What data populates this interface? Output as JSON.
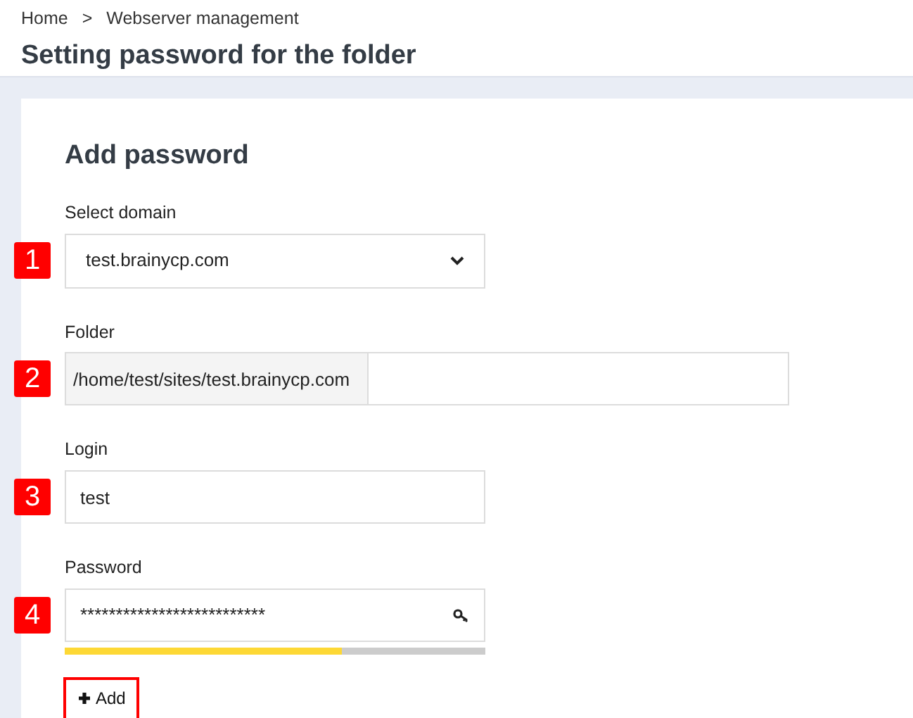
{
  "breadcrumb": [
    "Home",
    "Webserver management"
  ],
  "breadcrumb_separator": ">",
  "page_title": "Setting password for the folder",
  "form": {
    "title": "Add password",
    "fields": [
      {
        "kind": "select",
        "marker": "1",
        "label": "Select domain",
        "value": "test.brainycp.com"
      },
      {
        "kind": "prefixed",
        "marker": "2",
        "label": "Folder",
        "prefix": "/home/test/sites/test.brainycp.com"
      },
      {
        "kind": "text",
        "marker": "3",
        "label": "Login",
        "value": "test"
      },
      {
        "kind": "password",
        "marker": "4",
        "label": "Password",
        "value": "**************************",
        "level": 0.66
      }
    ],
    "add_button": {
      "label": "Add",
      "highlighted": true
    }
  }
}
